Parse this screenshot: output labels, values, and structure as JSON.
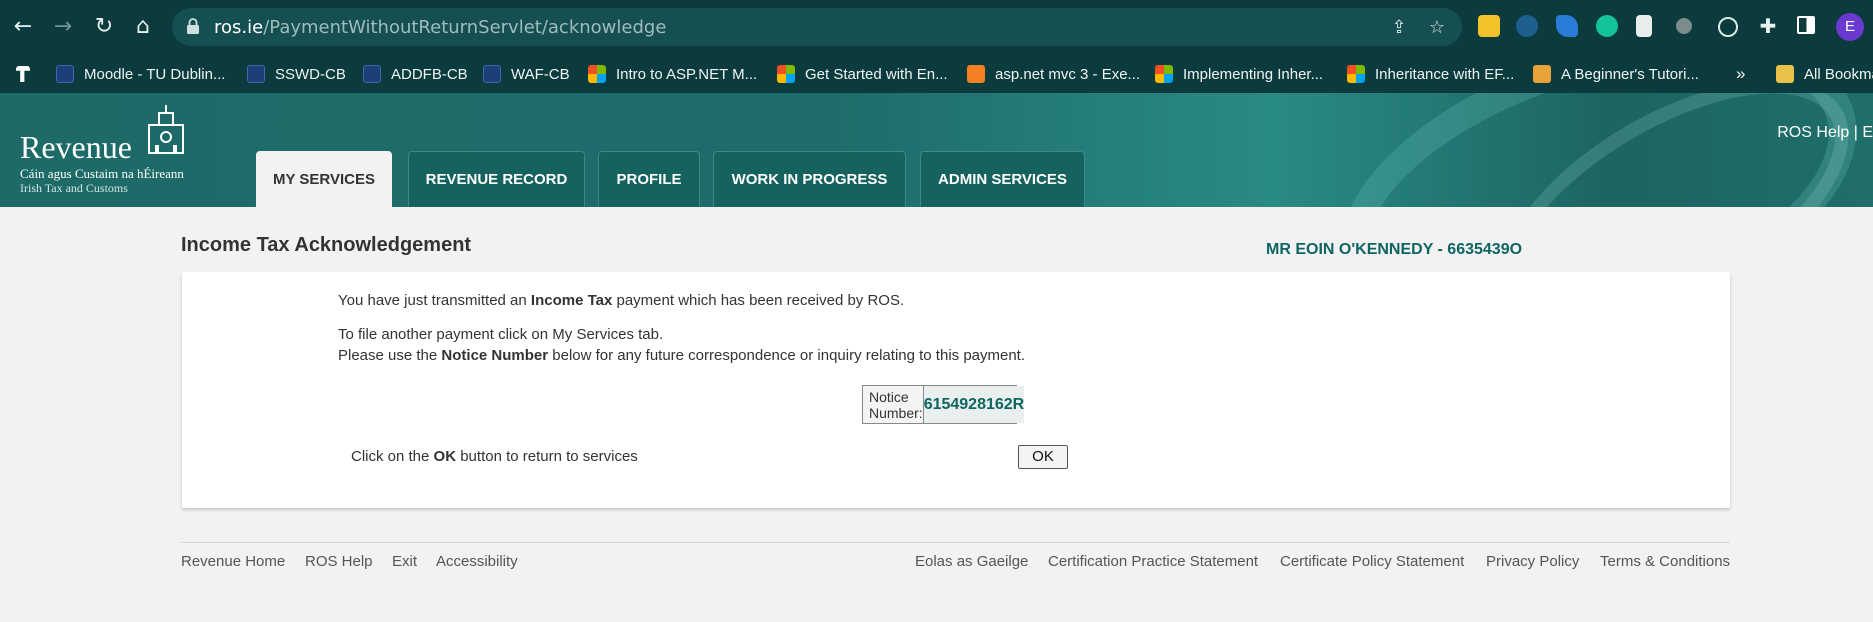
{
  "browser": {
    "url_host": "ros.ie",
    "url_path": "/PaymentWithoutReturnServlet/acknowledge",
    "profile_initial": "E",
    "bookmarks": [
      {
        "label": "Moodle - TU Dublin..."
      },
      {
        "label": "SSWD-CB"
      },
      {
        "label": "ADDFB-CB"
      },
      {
        "label": "WAF-CB"
      },
      {
        "label": "Intro to ASP.NET M..."
      },
      {
        "label": "Get Started with En..."
      },
      {
        "label": "asp.net mvc 3 - Exe..."
      },
      {
        "label": "Implementing Inher..."
      },
      {
        "label": "Inheritance with EF..."
      },
      {
        "label": "A Beginner's Tutori..."
      }
    ],
    "overflow_label": "»",
    "all_bookmarks": "All Bookma"
  },
  "header": {
    "logo_word": "Revenue",
    "logo_irish": "Cáin agus Custaim na hÉireann",
    "logo_english": "Irish Tax and Customs",
    "ros_help": "ROS Help | E",
    "tabs": [
      {
        "label": "MY SERVICES",
        "active": true
      },
      {
        "label": "REVENUE RECORD"
      },
      {
        "label": "PROFILE"
      },
      {
        "label": "WORK IN PROGRESS"
      },
      {
        "label": "ADMIN SERVICES"
      }
    ]
  },
  "main": {
    "title": "Income Tax Acknowledgement",
    "user": "MR EOIN O'KENNEDY - 6635439O",
    "line1_pre": "You have just transmitted an ",
    "line1_bold": "Income Tax",
    "line1_post": " payment which has been received by ROS.",
    "line2": "To file another payment click on My Services tab.",
    "line3_pre": "Please use the ",
    "line3_bold": "Notice Number",
    "line3_post": " below for any future correspondence or inquiry relating to this payment.",
    "notice_label": "Notice Number:",
    "notice_number": "6154928162R",
    "ok_pre": "Click on the ",
    "ok_bold": "OK",
    "ok_post": " button to return to services",
    "ok_button": "OK"
  },
  "footer": {
    "left": [
      "Revenue Home",
      "ROS Help",
      "Exit",
      "Accessibility"
    ],
    "right": [
      "Eolas as Gaeilge",
      "Certification Practice Statement",
      "Certificate Policy Statement",
      "Privacy Policy",
      "Terms & Conditions"
    ]
  },
  "colors": {
    "brand_teal": "#1d6a67",
    "accent_text": "#0e6561",
    "chrome_dark": "#0b3b3c"
  }
}
